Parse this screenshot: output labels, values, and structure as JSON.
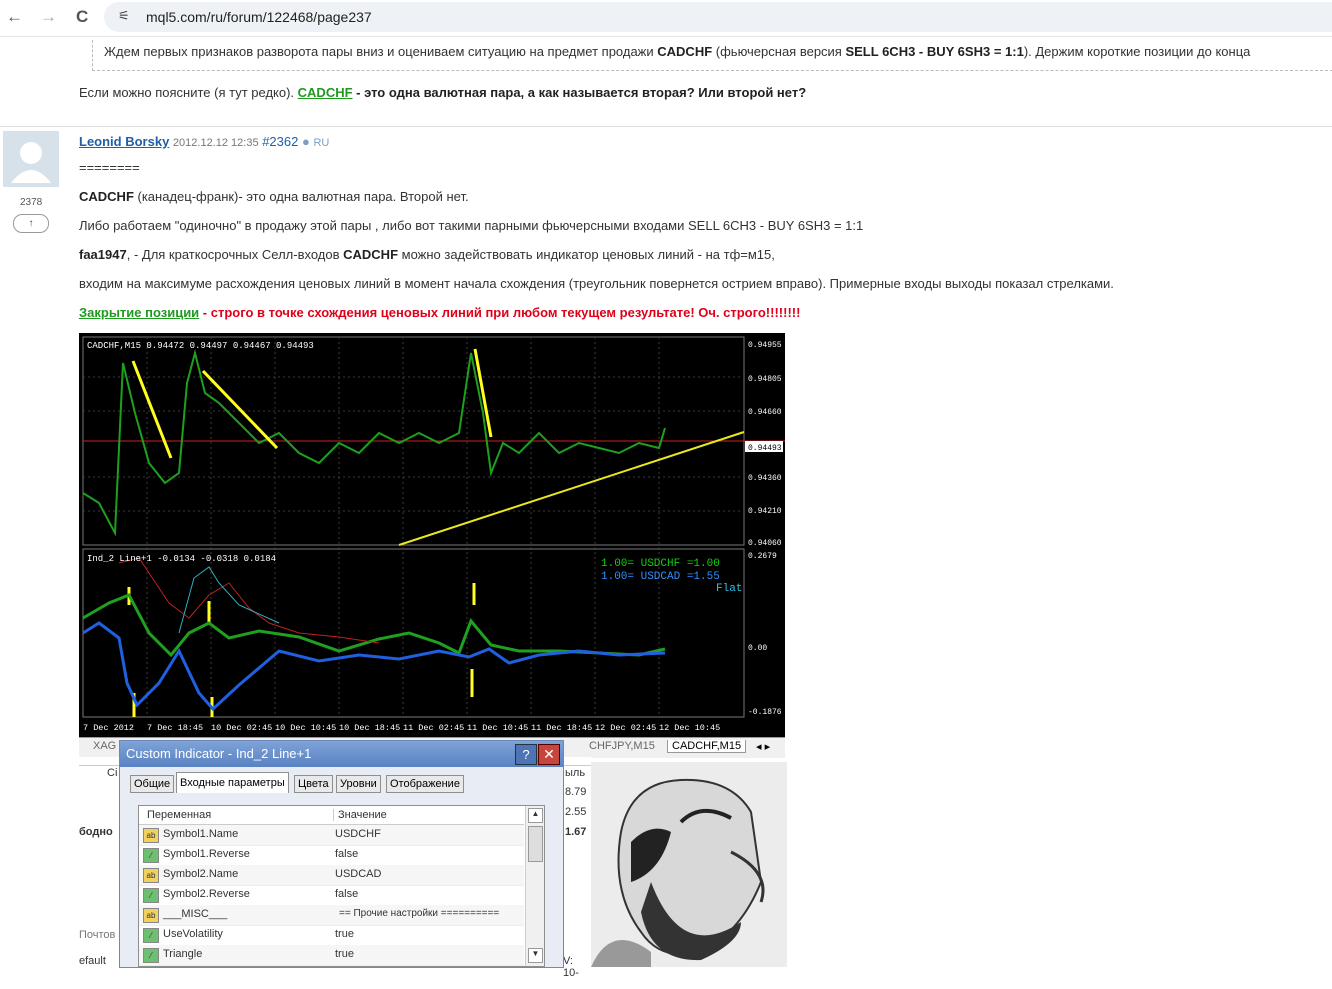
{
  "browser": {
    "back": "←",
    "forward": "→",
    "reload": "C",
    "url": "mql5.com/ru/forum/122468/page237",
    "tune_icon": "⚟"
  },
  "quote_text": {
    "pre": "Ждем первых признаков разворота пары вниз и оцениваем ситуацию на предмет продажи ",
    "pair": "CADCHF",
    "mid": " (фьючерсная версия ",
    "trade": "SELL 6CH3 - BUY 6SH3 = 1:1",
    "post": "). Держим короткие позиции до конца"
  },
  "question": {
    "pre": "Если можно поясните (я тут редко). ",
    "link": "CADCHF",
    "post": " - это одна валютная пара, а как называется вторая? Или второй нет?"
  },
  "post": {
    "author": "Leonid Borsky",
    "date": "2012.12.12 12:35",
    "num": "#2362",
    "lang": "RU",
    "rank": "2378",
    "up": "↑",
    "line0": "========",
    "line1_b": "CADCHF",
    "line1": " (канадец-франк)- это одна валютная пара. Второй нет.",
    "line2": "Либо работаем \"одиночно\" в продажу этой пары , либо  вот такими парными фьючерсными входами SELL 6CH3 - BUY 6SH3 = 1:1",
    "line3_b": "faa1947",
    "line3_a": ", - Для краткосрочных Селл-входов ",
    "line3_b2": "CADCHF",
    "line3_c": " можно задействовать индикатор ценовых линий - на тф=м15,",
    "line4": "входим на максимуме расхождения ценовых линий в момент начала схождения (треугольник повернется острием вправо). Примерные входы выходы показал стрелками.",
    "line5_link": "Закрытие позиции",
    "line5": " - строго в точке схождения ценовых линий при любом текущем результате! Оч. строго!!!!!!!!"
  },
  "chart": {
    "title": "CADCHF,M15  0.94472 0.94497 0.94467 0.94493",
    "price_ticks": [
      "0.94955",
      "0.94805",
      "0.94660",
      "0.94493",
      "0.94360",
      "0.94210",
      "0.94060"
    ],
    "ind_title": "Ind_2 Line+1 -0.0134 -0.0318 0.0184",
    "ind_ticks": [
      "0.2679",
      "0.00",
      "-0.1876"
    ],
    "legend1": "1.00= USDCHF =1.00",
    "legend2": "1.00= USDCAD =1.55",
    "legend3": "Flat",
    "x_ticks": [
      "7 Dec 2012",
      "7 Dec 18:45",
      "10 Dec 02:45",
      "10 Dec 10:45",
      "10 Dec 18:45",
      "11 Dec 02:45",
      "11 Dec 10:45",
      "11 Dec 18:45",
      "12 Dec 02:45",
      "12 Dec 10:45"
    ]
  },
  "terminal_tabs": {
    "t1": "XAG",
    "t2": "CHFJPY,M15",
    "t3": "CADCHF,M15",
    "t4": "◂ ▸"
  },
  "under": {
    "c1": "Сі",
    "v1": "8.79",
    "v2": "2.55",
    "v3": "1.67",
    "lbl": "ыль",
    "b": "бодно",
    "p": "Почтов",
    "d": "efault",
    "tv": "V: 10-"
  },
  "dialog": {
    "title": "Custom Indicator - Ind_2 Line+1",
    "help": "?",
    "close": "✕",
    "tabs": [
      "Общие",
      "Входные параметры",
      "Цвета",
      "Уровни",
      "Отображение"
    ],
    "col1": "Переменная",
    "col2": "Значение",
    "rows": [
      {
        "name": "Symbol1.Name",
        "value": "USDCHF",
        "type": "ab"
      },
      {
        "name": "Symbol1.Reverse",
        "value": "false",
        "type": "bool"
      },
      {
        "name": "Symbol2.Name",
        "value": "USDCAD",
        "type": "ab"
      },
      {
        "name": "Symbol2.Reverse",
        "value": "false",
        "type": "bool"
      },
      {
        "name": "___MISC___",
        "value": "== Прочие настройки ==========",
        "type": "ab"
      },
      {
        "name": "UseVolatility",
        "value": "true",
        "type": "bool"
      },
      {
        "name": "Triangle",
        "value": "true",
        "type": "bool"
      }
    ]
  }
}
